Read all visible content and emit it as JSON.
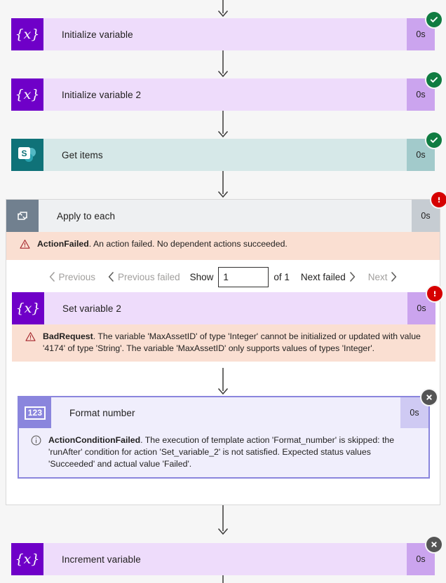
{
  "flow_run": {
    "actions": [
      {
        "id": "initialize-variable",
        "name": "Initialize variable",
        "duration": "0s",
        "status": "succeeded",
        "icon": "variable-braces-icon",
        "type": "variable"
      },
      {
        "id": "initialize-variable-2",
        "name": "Initialize variable 2",
        "duration": "0s",
        "status": "succeeded",
        "icon": "variable-braces-icon",
        "type": "variable"
      },
      {
        "id": "get-items",
        "name": "Get items",
        "duration": "0s",
        "status": "succeeded",
        "icon": "sharepoint-icon",
        "type": "sharepoint"
      },
      {
        "id": "apply-to-each",
        "name": "Apply to each",
        "duration": "0s",
        "status": "failed",
        "icon": "loop-repeat-icon",
        "type": "control"
      },
      {
        "id": "set-variable-2",
        "name": "Set variable 2",
        "duration": "0s",
        "status": "failed",
        "icon": "variable-braces-icon",
        "type": "variable"
      },
      {
        "id": "format-number",
        "name": "Format number",
        "duration": "0s",
        "status": "skipped",
        "icon": "number-123-icon",
        "type": "numfmt"
      },
      {
        "id": "increment-variable",
        "name": "Increment variable",
        "duration": "0s",
        "status": "skipped",
        "icon": "variable-braces-icon",
        "type": "variable"
      }
    ],
    "messages": {
      "apply_to_each": {
        "code": "ActionFailed",
        "text": ". An action failed. No dependent actions succeeded.",
        "severity": "error",
        "icon": "warning-triangle-icon"
      },
      "set_variable_2": {
        "code": "BadRequest",
        "text": ". The variable 'MaxAssetID' of type 'Integer' cannot be initialized or updated with value '4174' of type 'String'. The variable 'MaxAssetID' only supports values of types 'Integer'.",
        "severity": "error",
        "icon": "warning-triangle-icon"
      },
      "format_number": {
        "code": "ActionConditionFailed",
        "text": ". The execution of template action 'Format_number' is skipped: the 'runAfter' condition for action 'Set_variable_2' is not satisfied. Expected status values 'Succeeded' and actual value 'Failed'.",
        "severity": "info",
        "icon": "info-circle-icon"
      }
    },
    "pager": {
      "previous_label": "Previous",
      "previous_failed_label": "Previous failed",
      "show_label": "Show",
      "page_value": "1",
      "page_placeholder": "1",
      "of_label": "of 1",
      "next_failed_label": "Next failed",
      "next_label": "Next"
    },
    "colors": {
      "variable_accent": "#6f00c8",
      "variable_body": "#eedcfb",
      "variable_duration": "#cba4ee",
      "sharepoint_accent": "#0f7278",
      "sharepoint_body": "#d6e8e8",
      "control_accent": "#71808f",
      "control_body": "#eef0f2",
      "numfmt_accent": "#8a85dd",
      "numfmt_body": "#f0eefc",
      "status_succeeded": "#107c41",
      "status_failed": "#d60000",
      "status_skipped": "#545454",
      "error_strip": "#fadfd2",
      "canvas": "#f6f6f6"
    }
  }
}
